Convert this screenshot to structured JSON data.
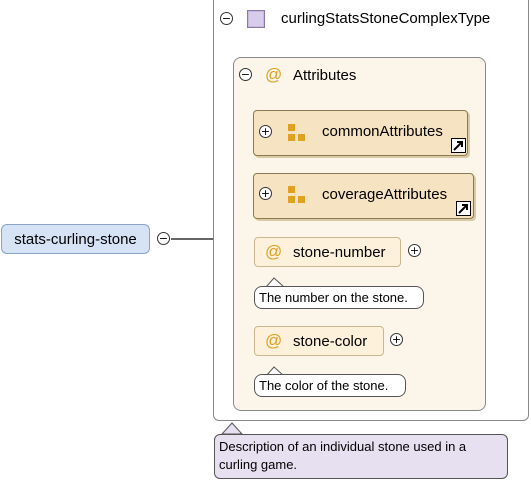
{
  "root": {
    "label": "stats-curling-stone"
  },
  "complex_type": {
    "name": "curlingStatsStoneComplexType"
  },
  "attributes_group": {
    "label": "Attributes"
  },
  "refs": [
    {
      "label": "commonAttributes"
    },
    {
      "label": "coverageAttributes"
    }
  ],
  "attributes": [
    {
      "label": "stone-number",
      "doc": "The number on the stone."
    },
    {
      "label": "stone-color",
      "doc": "The color of the stone."
    }
  ],
  "description": "Description of an individual stone used in a curling game.",
  "icons": {
    "collapse": "minus-circle-icon",
    "expand": "plus-circle-icon",
    "complex_type": "complex-type-icon",
    "attribute": "at-icon",
    "attribute_group": "attribute-group-icon",
    "reference": "reference-arrow-icon"
  },
  "colors": {
    "root_fill": "#d6e3f5",
    "ref_fill": "#f6e3c2",
    "attr_fill": "#fdf1dc",
    "desc_fill": "#e6e0f0",
    "icon_orange": "#e0a020"
  }
}
